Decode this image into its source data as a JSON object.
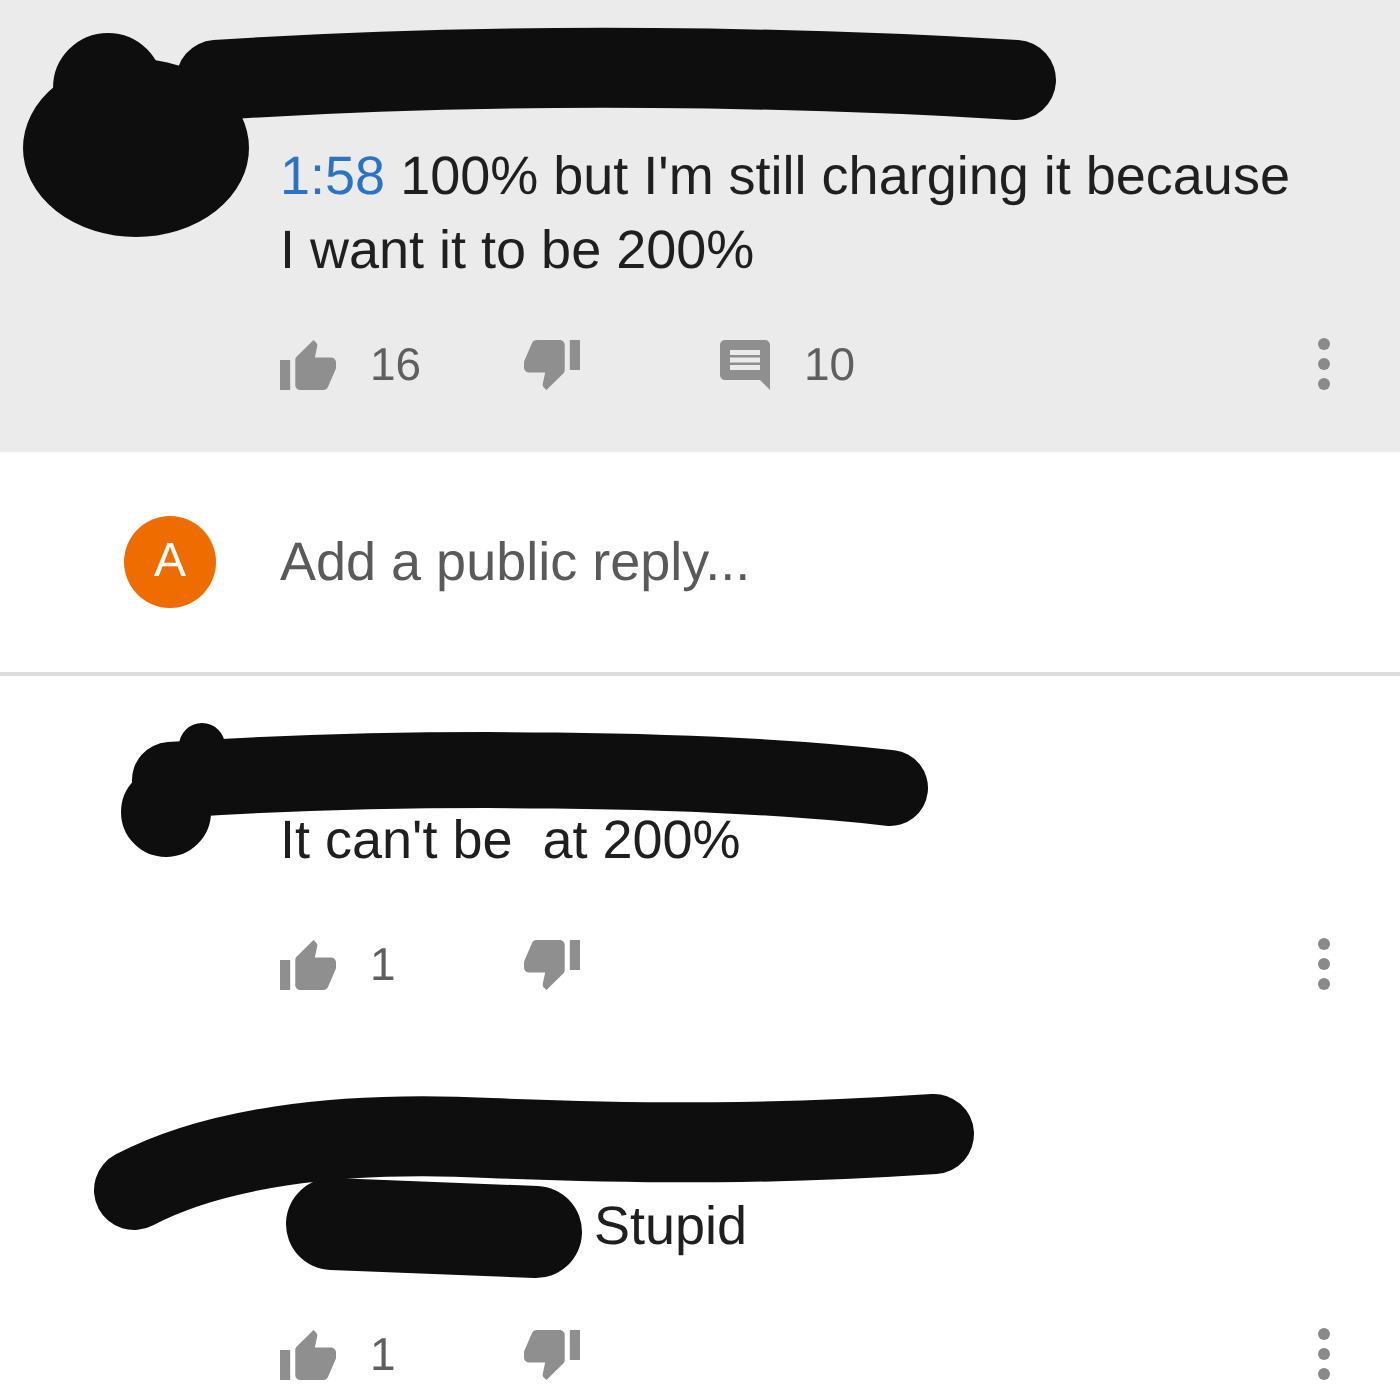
{
  "comment": {
    "redacted": true,
    "timestamp": "1:58",
    "text": "100% but I'm still charging it because I want it to be 200%",
    "likes": "16",
    "replies": "10"
  },
  "reply_box": {
    "avatar_letter": "A",
    "placeholder": "Add a public reply..."
  },
  "replies": [
    {
      "redacted": true,
      "mention_redacted": false,
      "text": "It can't be  at 200%",
      "likes": "1"
    },
    {
      "redacted": true,
      "mention_redacted": true,
      "text": "Stupid",
      "likes": "1"
    }
  ]
}
